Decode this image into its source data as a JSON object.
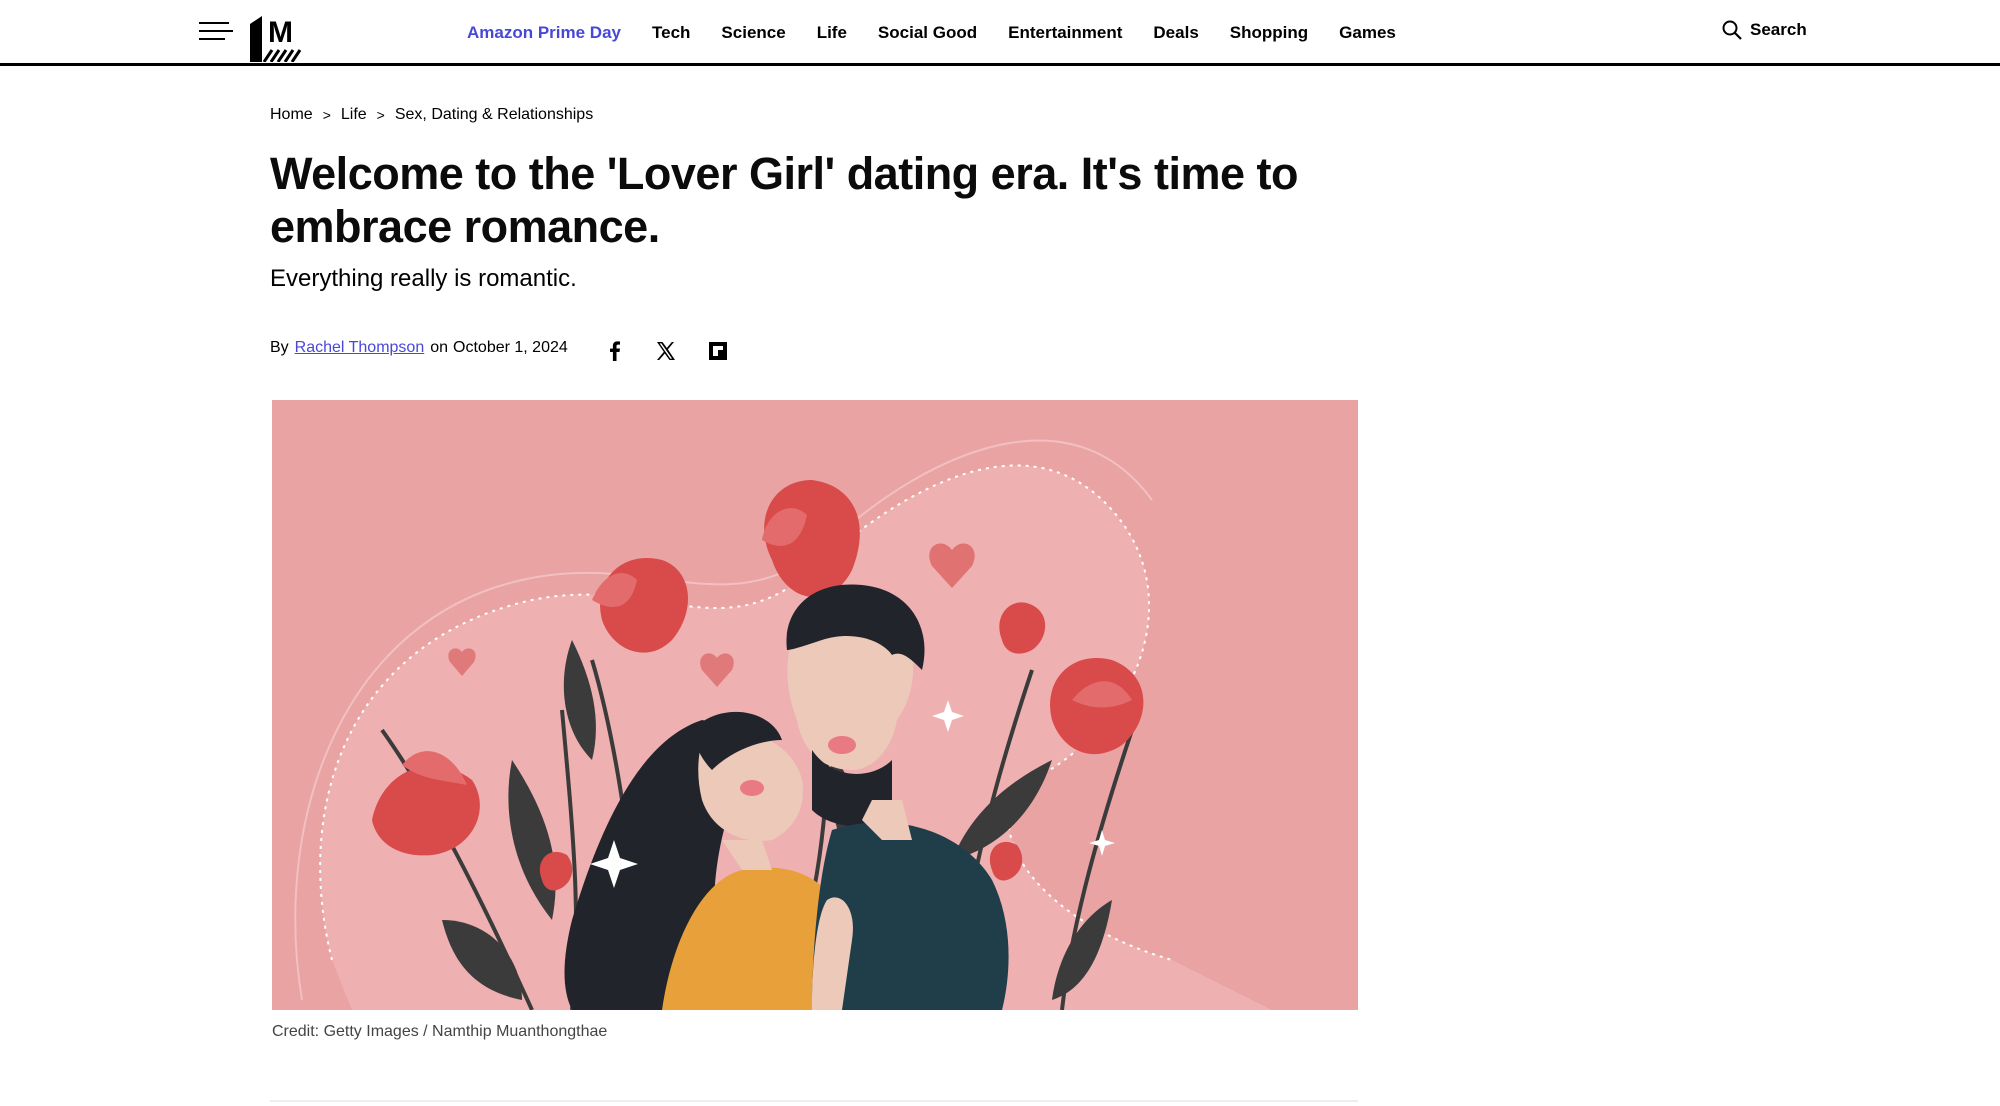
{
  "header": {
    "nav": [
      {
        "label": "Amazon Prime Day",
        "accent": true
      },
      {
        "label": "Tech"
      },
      {
        "label": "Science"
      },
      {
        "label": "Life"
      },
      {
        "label": "Social Good"
      },
      {
        "label": "Entertainment"
      },
      {
        "label": "Deals"
      },
      {
        "label": "Shopping"
      },
      {
        "label": "Games"
      }
    ],
    "search_label": "Search",
    "logo_letter": "M"
  },
  "breadcrumb": {
    "items": [
      "Home",
      "Life",
      "Sex, Dating & Relationships"
    ],
    "separator": ">"
  },
  "article": {
    "headline": "Welcome to the 'Lover Girl' dating era. It's time to embrace romance.",
    "dek": "Everything really is romantic.",
    "by": "By",
    "author": "Rachel Thompson",
    "date_prefix": "on",
    "date": "October 1, 2024",
    "share_icons": [
      "facebook-icon",
      "x-icon",
      "flipboard-icon"
    ],
    "image_credit": "Credit: Getty Images / Namthip Muanthongthae"
  },
  "colors": {
    "accent": "#4848d8",
    "hero_background": "#e9a3a3",
    "text": "#000000"
  }
}
